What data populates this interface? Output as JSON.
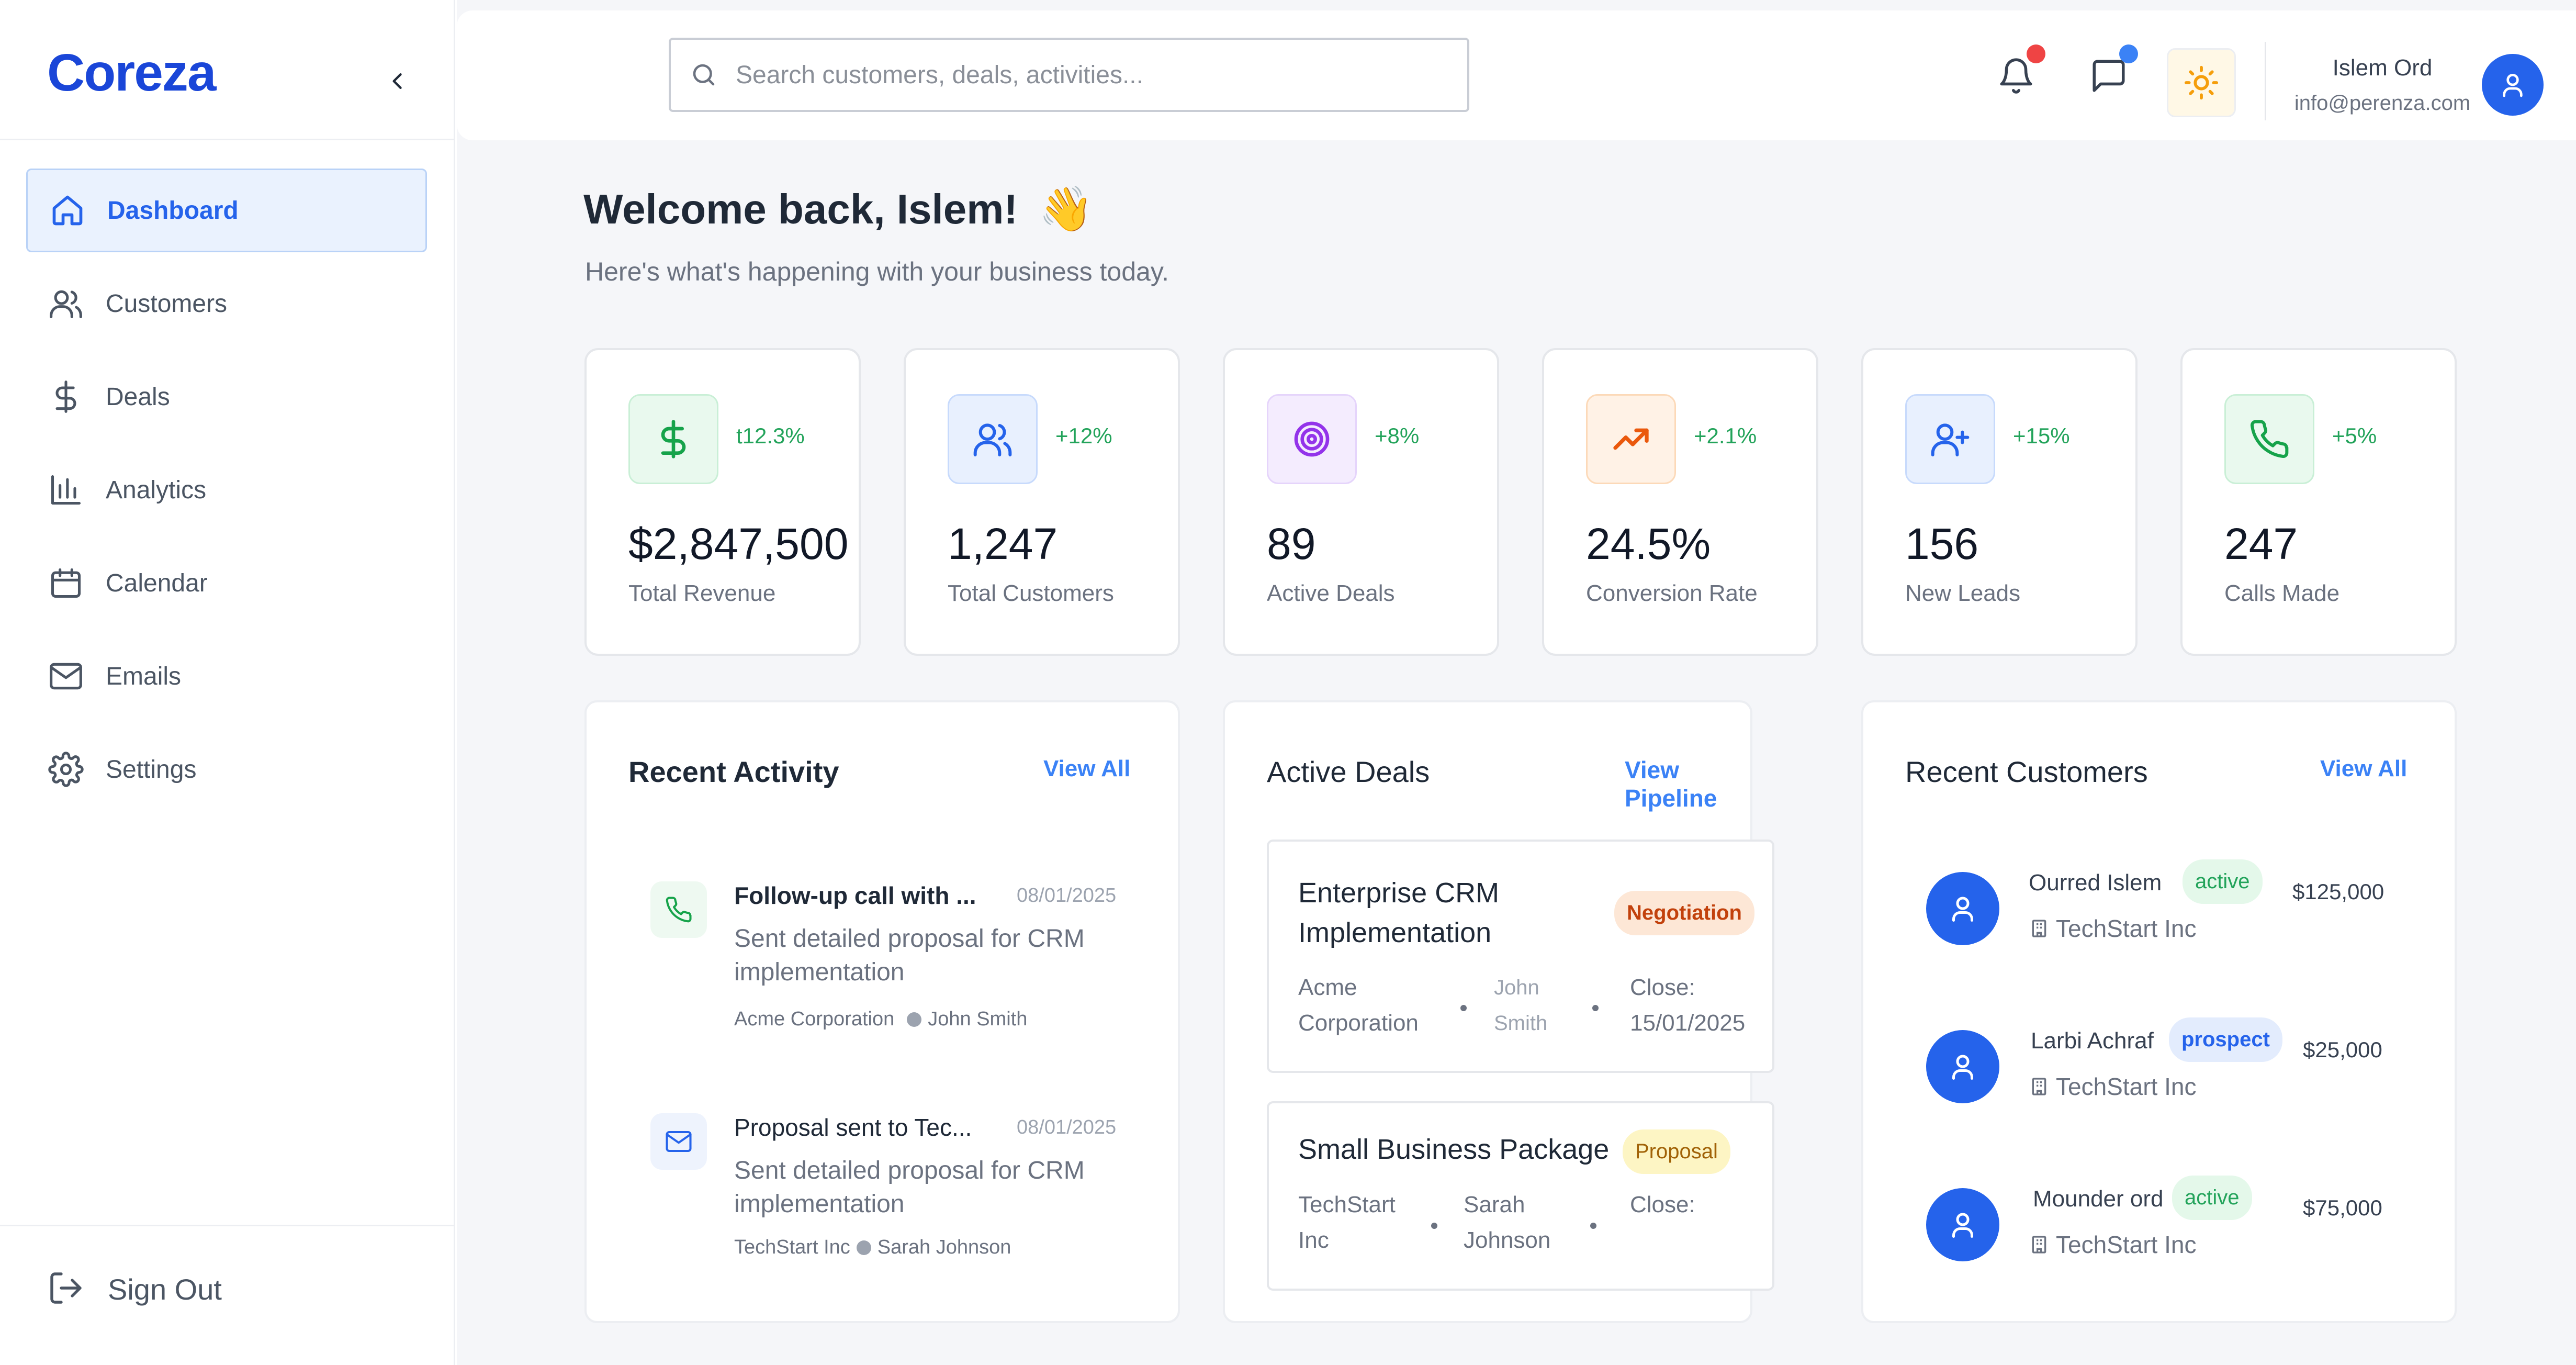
{
  "brand": {
    "logo_text": "Coreza",
    "accent": "#1a46d8"
  },
  "sidebar": {
    "items": [
      {
        "label": "Dashboard",
        "icon": "home-icon",
        "active": true
      },
      {
        "label": "Customers",
        "icon": "users-icon"
      },
      {
        "label": "Deals",
        "icon": "dollar-icon"
      },
      {
        "label": "Analytics",
        "icon": "bar-chart-icon"
      },
      {
        "label": "Calendar",
        "icon": "calendar-icon"
      },
      {
        "label": "Emails",
        "icon": "mail-icon"
      },
      {
        "label": "Settings",
        "icon": "gear-icon"
      }
    ],
    "signout_label": "Sign Out"
  },
  "header": {
    "search_placeholder": "Search customers, deals, activities...",
    "user_name": "Islem Ord",
    "user_email": "info@perenza.com",
    "notification_dot_color": "#ef4444",
    "message_dot_color": "#3b82f6"
  },
  "welcome": {
    "title": "Welcome back, Islem!",
    "emoji": "👋",
    "subtitle": "Here's what's happening with your business today."
  },
  "stats": [
    {
      "value": "$2,847,500",
      "label": "Total Revenue",
      "change": "t12.3%",
      "icon": "dollar-icon",
      "color": "#16a34a",
      "bg": "#e9f9ee"
    },
    {
      "value": "1,247",
      "label": "Total Customers",
      "change": "+12%",
      "icon": "users-icon",
      "color": "#2563eb",
      "bg": "#e8f0fe"
    },
    {
      "value": "89",
      "label": "Active Deals",
      "change": "+8%",
      "icon": "target-icon",
      "color": "#9333ea",
      "bg": "#f4ecfe"
    },
    {
      "value": "24.5%",
      "label": "Conversion Rate",
      "change": "+2.1%",
      "icon": "trending-up-icon",
      "color": "#ea580c",
      "bg": "#fff2e6"
    },
    {
      "value": "156",
      "label": "New Leads",
      "change": "+15%",
      "icon": "user-plus-icon",
      "color": "#2563eb",
      "bg": "#e8f0fe"
    },
    {
      "value": "247",
      "label": "Calls Made",
      "change": "+5%",
      "icon": "phone-icon",
      "color": "#16a34a",
      "bg": "#e9f9ee"
    }
  ],
  "recent_activity": {
    "title": "Recent Activity",
    "link": "View All",
    "items": [
      {
        "title": "Follow-up call with ...",
        "date": "08/01/2025",
        "desc": "Sent detailed proposal for CRM implementation",
        "company": "Acme Corporation",
        "person": "John Smith",
        "icon": "phone-icon"
      },
      {
        "title": "Proposal sent to Tec...",
        "date": "08/01/2025",
        "desc": "Sent detailed proposal for CRM implementation",
        "company": "TechStart Inc",
        "person": "Sarah Johnson",
        "icon": "mail-icon"
      }
    ]
  },
  "active_deals": {
    "title": "Active Deals",
    "link": "View Pipeline",
    "items": [
      {
        "name": "Enterprise CRM Implementation",
        "stage": "Negotiation",
        "company": "Acme Corporation",
        "owner": "John Smith",
        "close_label": "Close:",
        "close_date": "15/01/2025",
        "badge_bg": "#fde7d6",
        "badge_color": "#c2410c"
      },
      {
        "name": "Small Business Package",
        "stage": "Proposal",
        "company": "TechStart Inc",
        "owner": "Sarah Johnson",
        "close_label": "Close:",
        "close_date": "",
        "badge_bg": "#fdf5c4",
        "badge_color": "#a16207"
      }
    ]
  },
  "recent_customers": {
    "title": "Recent Customers",
    "link": "View All",
    "items": [
      {
        "name": "Ourred Islem",
        "status": "active",
        "company": "TechStart Inc",
        "amount": "$125,000"
      },
      {
        "name": "Larbi Achraf",
        "status": "prospect",
        "company": "TechStart Inc",
        "amount": "$25,000"
      },
      {
        "name": "Mounder ord",
        "status": "active",
        "company": "TechStart Inc",
        "amount": "$75,000"
      }
    ]
  }
}
